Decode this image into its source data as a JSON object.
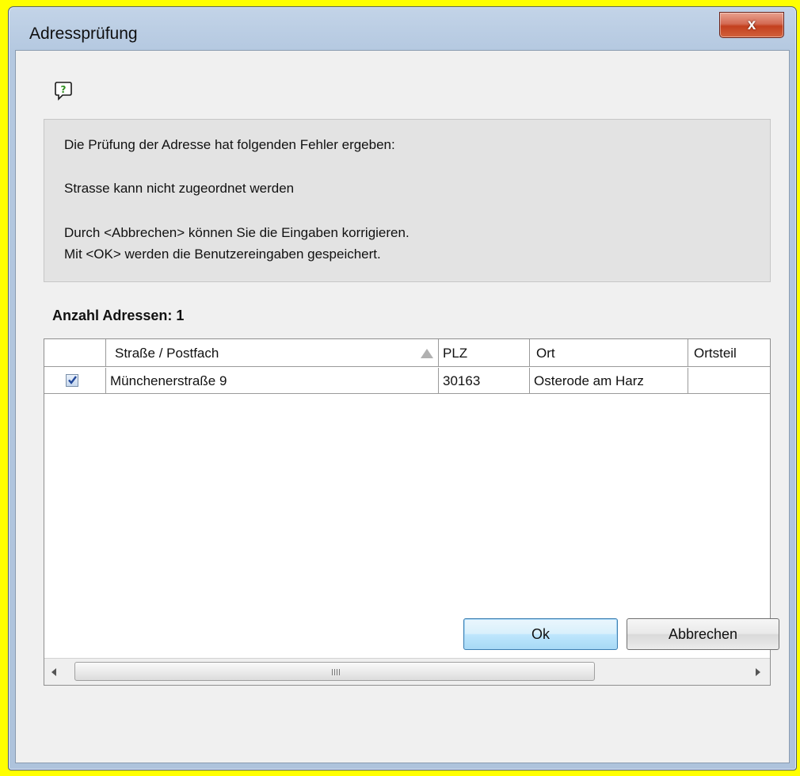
{
  "window": {
    "title": "Adressprüfung",
    "close_label": "x"
  },
  "message": {
    "line1": "Die Prüfung der Adresse hat folgenden Fehler ergeben:",
    "line2": "Strasse kann nicht zugeordnet werden",
    "line3": "Durch <Abbrechen> können Sie die Eingaben korrigieren.",
    "line4": "Mit <OK> werden die Benutzereingaben gespeichert."
  },
  "count_label": "Anzahl Adressen: 1",
  "table": {
    "columns": [
      "",
      "Straße / Postfach",
      "PLZ",
      "Ort",
      "Ortsteil"
    ],
    "rows": [
      {
        "checked": true,
        "street": "Münchenerstraße 9",
        "plz": "30163",
        "ort": "Osterode am Harz",
        "ortsteil": ""
      }
    ],
    "scrollbar_grip": "III"
  },
  "buttons": {
    "ok": "Ok",
    "cancel": "Abbrechen"
  },
  "colors": {
    "accent": "#3c7fb1",
    "close_button": "#c3401f",
    "frame": "#b4c8e0"
  }
}
